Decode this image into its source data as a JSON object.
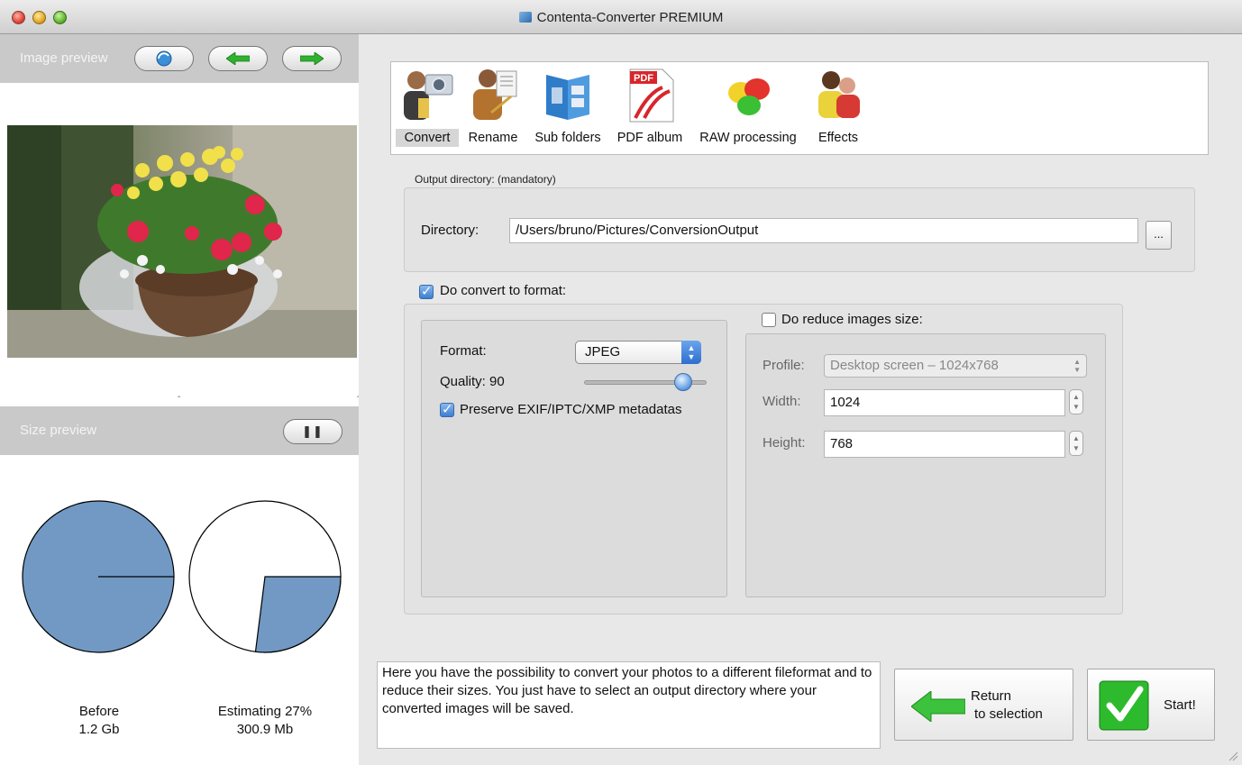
{
  "window": {
    "title": "Contenta-Converter PREMIUM"
  },
  "left": {
    "image_preview": {
      "label": "Image preview",
      "buttons": [
        "refresh-icon",
        "arrow-left-icon",
        "arrow-right-icon"
      ]
    },
    "size_preview": {
      "label": "Size preview",
      "pause_icon": "pause-icon"
    },
    "pies": {
      "before": {
        "caption": "Before",
        "size": "1.2 Gb",
        "fill_fraction": 1.0
      },
      "after": {
        "caption": "Estimating 27%",
        "size": "300.9 Mb",
        "fill_fraction": 0.27
      },
      "fill_color": "#7199c4"
    }
  },
  "toolbar": {
    "items": [
      {
        "label": "Convert",
        "icon": "camera-person-icon",
        "selected": true
      },
      {
        "label": "Rename",
        "icon": "person-writing-icon",
        "selected": false
      },
      {
        "label": "Sub folders",
        "icon": "book-folders-icon",
        "selected": false
      },
      {
        "label": "PDF album",
        "icon": "pdf-icon",
        "selected": false,
        "badge": "PDF"
      },
      {
        "label": "RAW processing",
        "icon": "color-balls-icon",
        "selected": false
      },
      {
        "label": "Effects",
        "icon": "people-effects-icon",
        "selected": false
      }
    ]
  },
  "output": {
    "caption": "Output directory: (mandatory)",
    "directory_label": "Directory:",
    "directory_value": "/Users/bruno/Pictures/ConversionOutput",
    "browse_label": "..."
  },
  "convert": {
    "checkbox_label": "Do convert to format:",
    "checked": true,
    "format_label": "Format:",
    "format_value": "JPEG",
    "quality_label": "Quality: 90",
    "quality_value": 90,
    "preserve_label": "Preserve EXIF/IPTC/XMP metadatas",
    "preserve_checked": true
  },
  "reduce": {
    "checkbox_label": "Do reduce images size:",
    "checked": false,
    "profile_label": "Profile:",
    "profile_value": "Desktop screen – 1024x768",
    "width_label": "Width:",
    "width_value": "1024",
    "height_label": "Height:",
    "height_value": "768"
  },
  "info": {
    "text": "Here you have the possibility to convert your photos to a different fileformat and to reduce their sizes. You just have to select an output directory where your converted images will be saved."
  },
  "actions": {
    "return_line1": "Return",
    "return_line2": "to selection",
    "start_label": "Start!"
  }
}
